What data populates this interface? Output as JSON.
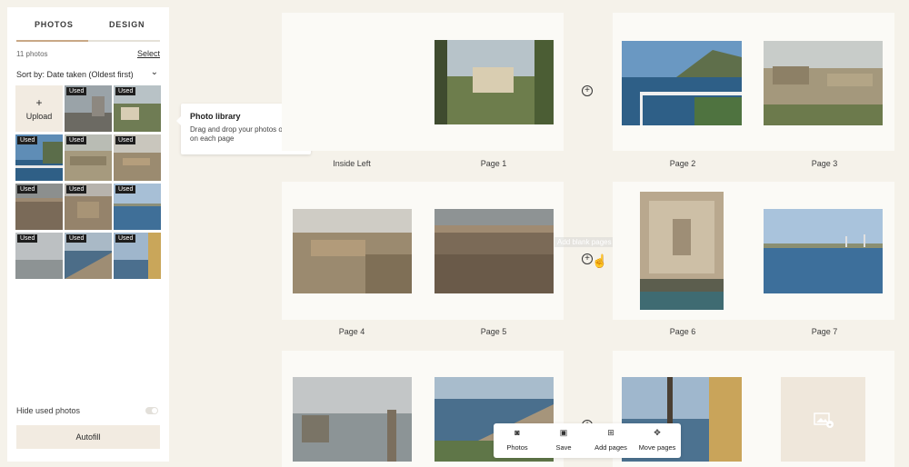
{
  "sidebar": {
    "tabs": [
      {
        "label": "PHOTOS"
      },
      {
        "label": "DESIGN"
      }
    ],
    "photo_count": "11 photos",
    "select_label": "Select",
    "sort_label": "Sort by:",
    "sort_value": "Date taken (Oldest first)",
    "upload_label": "Upload",
    "used_label": "Used",
    "hide_used_label": "Hide used photos",
    "autofill_label": "Autofill"
  },
  "tooltip": {
    "title": "Photo library",
    "body": "Drag and drop your photos or click on each page"
  },
  "pages": {
    "inside_left": "Inside Left",
    "p1": "Page 1",
    "p2": "Page 2",
    "p3": "Page 3",
    "p4": "Page 4",
    "p5": "Page 5",
    "p6": "Page 6",
    "p7": "Page 7"
  },
  "blank_pages_tip": "Add blank pages (+$120)",
  "toolbar": {
    "photos": "Photos",
    "save": "Save",
    "add_pages": "Add pages",
    "move_pages": "Move pages"
  },
  "colors": {
    "background": "#f5f2ea",
    "accent": "#c9a886",
    "used_badge": "#1e1e1e",
    "button_fill": "#f2ebe1"
  }
}
